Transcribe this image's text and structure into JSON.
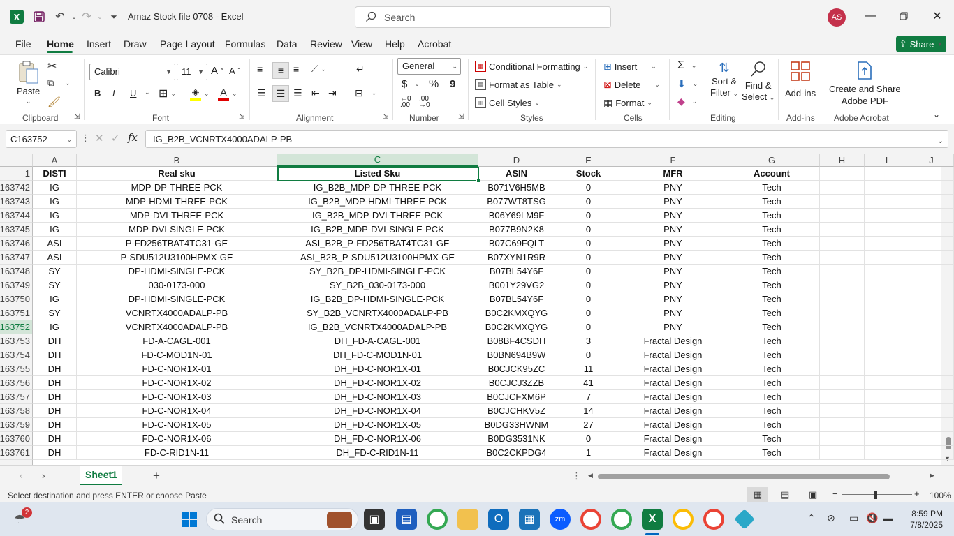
{
  "window": {
    "title": "Amaz Stock file 0708  -  Excel",
    "search_placeholder": "Search",
    "user_initials": "AS"
  },
  "menu": {
    "tabs": [
      "File",
      "Home",
      "Insert",
      "Draw",
      "Page Layout",
      "Formulas",
      "Data",
      "Review",
      "View",
      "Help",
      "Acrobat"
    ],
    "active_tab": "Home",
    "share_label": "Share"
  },
  "ribbon": {
    "clipboard": {
      "paste": "Paste",
      "label": "Clipboard"
    },
    "font": {
      "name": "Calibri",
      "size": "11",
      "bold": "B",
      "italic": "I",
      "underline": "U",
      "label": "Font"
    },
    "alignment": {
      "label": "Alignment"
    },
    "number": {
      "format": "General",
      "currency": "$",
      "percent": "%",
      "comma": "9",
      "label": "Number"
    },
    "styles": {
      "conditional": "Conditional Formatting",
      "format_table": "Format as Table",
      "cell_styles": "Cell Styles",
      "label": "Styles"
    },
    "cells": {
      "insert": "Insert",
      "delete": "Delete",
      "format": "Format",
      "label": "Cells"
    },
    "editing": {
      "sort1": "Sort &",
      "sort2": "Filter",
      "find1": "Find &",
      "find2": "Select",
      "label": "Editing"
    },
    "addins": {
      "button": "Add-ins",
      "label": "Add-ins"
    },
    "acrobat": {
      "line1": "Create and Share",
      "line2": "Adobe PDF",
      "label": "Adobe Acrobat"
    }
  },
  "formula_bar": {
    "name_box": "C163752",
    "fx": "fx",
    "content": "IG_B2B_VCNRTX4000ADALP-PB"
  },
  "columns": [
    "A",
    "B",
    "C",
    "D",
    "E",
    "F",
    "G",
    "H",
    "I",
    "J"
  ],
  "selected_column": "C",
  "headers": {
    "row": "1",
    "cells": [
      "DISTI",
      "Real sku",
      "Listed Sku",
      "ASIN",
      "Stock",
      "MFR",
      "Account",
      "",
      ""
    ]
  },
  "rows": [
    {
      "n": "163742",
      "c": [
        "IG",
        "MDP-DP-THREE-PCK",
        "IG_B2B_MDP-DP-THREE-PCK",
        "B071V6H5MB",
        "0",
        "PNY",
        "Tech"
      ]
    },
    {
      "n": "163743",
      "c": [
        "IG",
        "MDP-HDMI-THREE-PCK",
        "IG_B2B_MDP-HDMI-THREE-PCK",
        "B077WT8TSG",
        "0",
        "PNY",
        "Tech"
      ]
    },
    {
      "n": "163744",
      "c": [
        "IG",
        "MDP-DVI-THREE-PCK",
        "IG_B2B_MDP-DVI-THREE-PCK",
        "B06Y69LM9F",
        "0",
        "PNY",
        "Tech"
      ]
    },
    {
      "n": "163745",
      "c": [
        "IG",
        "MDP-DVI-SINGLE-PCK",
        "IG_B2B_MDP-DVI-SINGLE-PCK",
        "B077B9N2K8",
        "0",
        "PNY",
        "Tech"
      ]
    },
    {
      "n": "163746",
      "c": [
        "ASI",
        "P-FD256TBAT4TC31-GE",
        "ASI_B2B_P-FD256TBAT4TC31-GE",
        "B07C69FQLT",
        "0",
        "PNY",
        "Tech"
      ]
    },
    {
      "n": "163747",
      "c": [
        "ASI",
        "P-SDU512U3100HPMX-GE",
        "ASI_B2B_P-SDU512U3100HPMX-GE",
        "B07XYN1R9R",
        "0",
        "PNY",
        "Tech"
      ]
    },
    {
      "n": "163748",
      "c": [
        "SY",
        "DP-HDMI-SINGLE-PCK",
        "SY_B2B_DP-HDMI-SINGLE-PCK",
        "B07BL54Y6F",
        "0",
        "PNY",
        "Tech"
      ]
    },
    {
      "n": "163749",
      "c": [
        "SY",
        "030-0173-000",
        "SY_B2B_030-0173-000",
        "B001Y29VG2",
        "0",
        "PNY",
        "Tech"
      ]
    },
    {
      "n": "163750",
      "c": [
        "IG",
        "DP-HDMI-SINGLE-PCK",
        "IG_B2B_DP-HDMI-SINGLE-PCK",
        "B07BL54Y6F",
        "0",
        "PNY",
        "Tech"
      ]
    },
    {
      "n": "163751",
      "c": [
        "SY",
        "VCNRTX4000ADALP-PB",
        "SY_B2B_VCNRTX4000ADALP-PB",
        "B0C2KMXQYG",
        "0",
        "PNY",
        "Tech"
      ]
    },
    {
      "n": "163752",
      "c": [
        "IG",
        "VCNRTX4000ADALP-PB",
        "IG_B2B_VCNRTX4000ADALP-PB",
        "B0C2KMXQYG",
        "0",
        "PNY",
        "Tech"
      ]
    },
    {
      "n": "163753",
      "c": [
        "DH",
        "FD-A-CAGE-001",
        "DH_FD-A-CAGE-001",
        "B08BF4CSDH",
        "3",
        "Fractal Design",
        "Tech"
      ]
    },
    {
      "n": "163754",
      "c": [
        "DH",
        "FD-C-MOD1N-01",
        "DH_FD-C-MOD1N-01",
        "B0BN694B9W",
        "0",
        "Fractal Design",
        "Tech"
      ]
    },
    {
      "n": "163755",
      "c": [
        "DH",
        "FD-C-NOR1X-01",
        "DH_FD-C-NOR1X-01",
        "B0CJCK95ZC",
        "11",
        "Fractal Design",
        "Tech"
      ]
    },
    {
      "n": "163756",
      "c": [
        "DH",
        "FD-C-NOR1X-02",
        "DH_FD-C-NOR1X-02",
        "B0CJCJ3ZZB",
        "41",
        "Fractal Design",
        "Tech"
      ]
    },
    {
      "n": "163757",
      "c": [
        "DH",
        "FD-C-NOR1X-03",
        "DH_FD-C-NOR1X-03",
        "B0CJCFXM6P",
        "7",
        "Fractal Design",
        "Tech"
      ]
    },
    {
      "n": "163758",
      "c": [
        "DH",
        "FD-C-NOR1X-04",
        "DH_FD-C-NOR1X-04",
        "B0CJCHKV5Z",
        "14",
        "Fractal Design",
        "Tech"
      ]
    },
    {
      "n": "163759",
      "c": [
        "DH",
        "FD-C-NOR1X-05",
        "DH_FD-C-NOR1X-05",
        "B0DG33HWNM",
        "27",
        "Fractal Design",
        "Tech"
      ]
    },
    {
      "n": "163760",
      "c": [
        "DH",
        "FD-C-NOR1X-06",
        "DH_FD-C-NOR1X-06",
        "B0DG3531NK",
        "0",
        "Fractal Design",
        "Tech"
      ]
    },
    {
      "n": "163761",
      "c": [
        "DH",
        "FD-C-RID1N-11",
        "DH_FD-C-RID1N-11",
        "B0C2CKPDG4",
        "1",
        "Fractal Design",
        "Tech"
      ]
    }
  ],
  "active_row": "163752",
  "sheet": {
    "tab": "Sheet1",
    "add": "+"
  },
  "status": {
    "message": "Select destination and press ENTER or choose Paste",
    "zoom": "100%"
  },
  "taskbar": {
    "search": "Search",
    "time": "8:59 PM",
    "date": "7/8/2025",
    "badge": "2"
  },
  "colors": {
    "accent": "#107c41",
    "selected_header": "#d3e5d8"
  }
}
